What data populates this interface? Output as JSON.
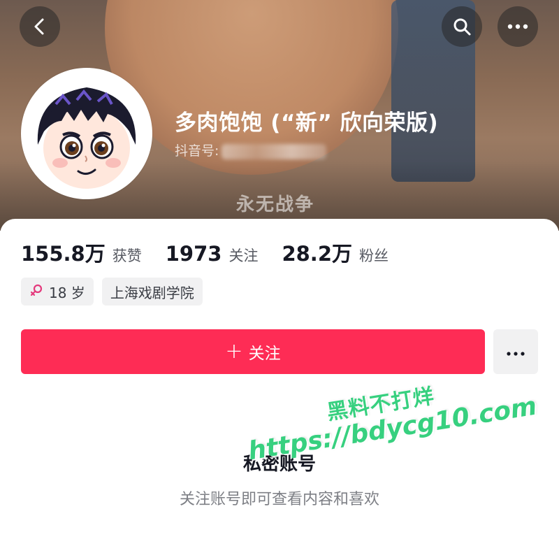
{
  "header": {
    "username": "多肉饱饱 (“新” 欣向荣版)",
    "douyin_id_label": "抖音号:",
    "banner_text": "永无战争",
    "icons": {
      "back": "back-chevron-icon",
      "search": "search-icon",
      "more": "more-dots-icon"
    }
  },
  "stats": [
    {
      "value": "155.8万",
      "label": "获赞"
    },
    {
      "value": "1973",
      "label": "关注"
    },
    {
      "value": "28.2万",
      "label": "粉丝"
    }
  ],
  "tags": {
    "age": "18 岁",
    "school": "上海戏剧学院",
    "gender_icon": "female-icon"
  },
  "actions": {
    "follow_plus": "+",
    "follow_label": "关注"
  },
  "private_notice": {
    "title": "私密账号",
    "subtitle": "关注账号即可查看内容和喜欢"
  },
  "watermark": {
    "line1": "黑料不打烊",
    "line2": "https://bdycg10.com"
  },
  "colors": {
    "accent": "#fe2c55",
    "watermark": "#37d07f",
    "tag_bg": "#f1f1f2"
  }
}
